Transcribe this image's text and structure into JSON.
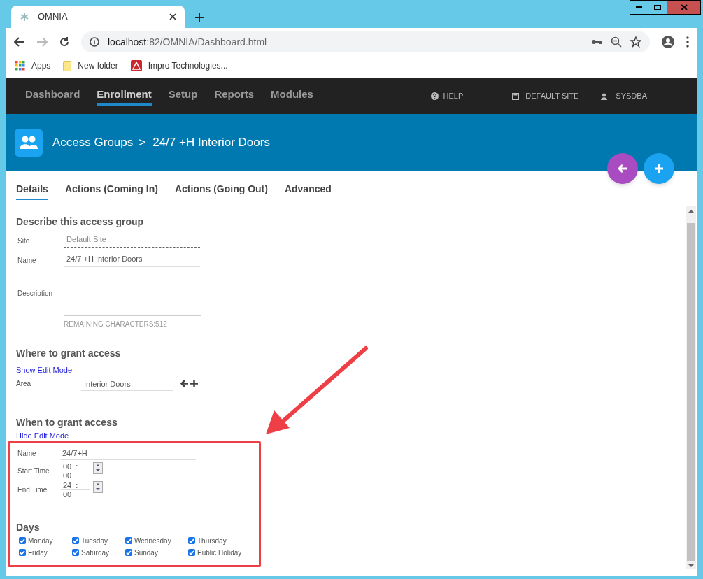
{
  "browser": {
    "tab_title": "OMNIA",
    "url_host": "localhost",
    "url_path": ":82/OMNIA/Dashboard.html",
    "bookmarks": [
      {
        "kind": "apps",
        "label": "Apps"
      },
      {
        "kind": "folder",
        "label": "New folder"
      },
      {
        "kind": "site",
        "label": "Impro Technologies..."
      }
    ]
  },
  "nav": {
    "items": [
      {
        "label": "Dashboard",
        "selected": false
      },
      {
        "label": "Enrollment",
        "selected": true
      },
      {
        "label": "Setup",
        "selected": false
      },
      {
        "label": "Reports",
        "selected": false
      },
      {
        "label": "Modules",
        "selected": false
      }
    ],
    "help": "HELP",
    "site": "DEFAULT SITE",
    "user": "SYSDBA"
  },
  "header": {
    "breadcrumb": "Access Groups",
    "separator": ">",
    "title": "24/7 +H Interior Doors"
  },
  "tabs": [
    {
      "label": "Details",
      "selected": true
    },
    {
      "label": "Actions (Coming In)",
      "selected": false
    },
    {
      "label": "Actions (Going Out)",
      "selected": false
    },
    {
      "label": "Advanced",
      "selected": false
    }
  ],
  "describe": {
    "heading": "Describe this access group",
    "site_label": "Site",
    "site_value": "Default Site",
    "name_label": "Name",
    "name_value": "24/7 +H Interior Doors",
    "description_label": "Description",
    "remaining": "REMAINING CHARACTERS:512"
  },
  "where": {
    "heading": "Where to grant access",
    "edit_link": "Show Edit Mode",
    "area_label": "Area",
    "area_value": "Interior Doors"
  },
  "when": {
    "heading": "When to grant access",
    "edit_link": "Hide Edit Mode",
    "name_label": "Name",
    "name_value": "24/7+H",
    "times": [
      {
        "label": "Start Time",
        "hours": "00",
        "separator": ":",
        "minutes": "00"
      },
      {
        "label": "End Time",
        "hours": "24",
        "separator": ":",
        "minutes": "00"
      }
    ],
    "days_heading": "Days",
    "days": [
      {
        "label": "Monday",
        "checked": true
      },
      {
        "label": "Tuesday",
        "checked": true
      },
      {
        "label": "Wednesday",
        "checked": true
      },
      {
        "label": "Thursday",
        "checked": true
      },
      {
        "label": "Friday",
        "checked": true
      },
      {
        "label": "Saturday",
        "checked": true
      },
      {
        "label": "Sunday",
        "checked": true
      },
      {
        "label": "Public Holiday",
        "checked": true
      }
    ]
  }
}
